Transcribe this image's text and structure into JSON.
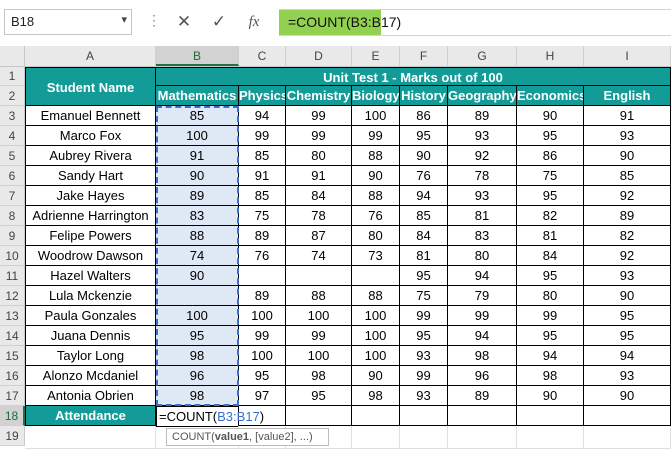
{
  "namebox": {
    "value": "B18",
    "arrow": "▾"
  },
  "formula_bar": {
    "dots": "⋮",
    "cancel_icon": "✕",
    "enter_icon": "✓",
    "fx_icon": "fx",
    "formula": "=COUNT(B3:B17)"
  },
  "columns": [
    "A",
    "B",
    "C",
    "D",
    "E",
    "F",
    "G",
    "H",
    "I"
  ],
  "rows": [
    "1",
    "2",
    "3",
    "4",
    "5",
    "6",
    "7",
    "8",
    "9",
    "10",
    "11",
    "12",
    "13",
    "14",
    "15",
    "16",
    "17",
    "18",
    "19"
  ],
  "table": {
    "student_header": "Student Name",
    "group_header": "Unit Test 1 - Marks out of 100",
    "subjects": [
      "Mathematics",
      "Physics",
      "Chemistry",
      "Biology",
      "History",
      "Geography",
      "Economics",
      "English"
    ],
    "students": [
      {
        "name": "Emanuel Bennett",
        "marks": [
          "85",
          "94",
          "99",
          "100",
          "86",
          "89",
          "90",
          "91"
        ]
      },
      {
        "name": "Marco Fox",
        "marks": [
          "100",
          "99",
          "99",
          "99",
          "95",
          "93",
          "95",
          "93"
        ]
      },
      {
        "name": "Aubrey Rivera",
        "marks": [
          "91",
          "85",
          "80",
          "88",
          "90",
          "92",
          "86",
          "90"
        ]
      },
      {
        "name": "Sandy Hart",
        "marks": [
          "90",
          "91",
          "91",
          "90",
          "76",
          "78",
          "75",
          "85"
        ]
      },
      {
        "name": "Jake Hayes",
        "marks": [
          "89",
          "85",
          "84",
          "88",
          "94",
          "93",
          "95",
          "92"
        ]
      },
      {
        "name": "Adrienne Harrington",
        "marks": [
          "83",
          "75",
          "78",
          "76",
          "85",
          "81",
          "82",
          "89"
        ]
      },
      {
        "name": "Felipe Powers",
        "marks": [
          "88",
          "89",
          "87",
          "80",
          "84",
          "83",
          "81",
          "82"
        ]
      },
      {
        "name": "Woodrow Dawson",
        "marks": [
          "74",
          "76",
          "74",
          "73",
          "81",
          "80",
          "84",
          "92"
        ]
      },
      {
        "name": "Hazel Walters",
        "marks": [
          "90",
          "",
          "",
          "",
          "95",
          "94",
          "95",
          "93"
        ]
      },
      {
        "name": "Lula Mckenzie",
        "marks": [
          "",
          "89",
          "88",
          "88",
          "75",
          "79",
          "80",
          "90"
        ]
      },
      {
        "name": "Paula Gonzales",
        "marks": [
          "100",
          "100",
          "100",
          "100",
          "99",
          "99",
          "99",
          "95"
        ]
      },
      {
        "name": "Juana Dennis",
        "marks": [
          "95",
          "99",
          "99",
          "100",
          "95",
          "94",
          "95",
          "95"
        ]
      },
      {
        "name": "Taylor Long",
        "marks": [
          "98",
          "100",
          "100",
          "100",
          "93",
          "98",
          "94",
          "94"
        ]
      },
      {
        "name": "Alonzo Mcdaniel",
        "marks": [
          "96",
          "95",
          "98",
          "90",
          "99",
          "96",
          "98",
          "93"
        ]
      },
      {
        "name": "Antonia Obrien",
        "marks": [
          "98",
          "97",
          "95",
          "98",
          "93",
          "89",
          "90",
          "90"
        ]
      }
    ],
    "attendance_label": "Attendance",
    "edit": {
      "prefix": "=COUNT(",
      "ref": "B3:B17",
      "suffix": ")"
    }
  },
  "tooltip": {
    "func": "COUNT(",
    "arg1": "value1",
    "rest": ", [value2], ...)"
  },
  "colors": {
    "header_teal": "#139b98",
    "formula_highlight": "#92d050",
    "selection_blue": "#3a6fd0"
  }
}
